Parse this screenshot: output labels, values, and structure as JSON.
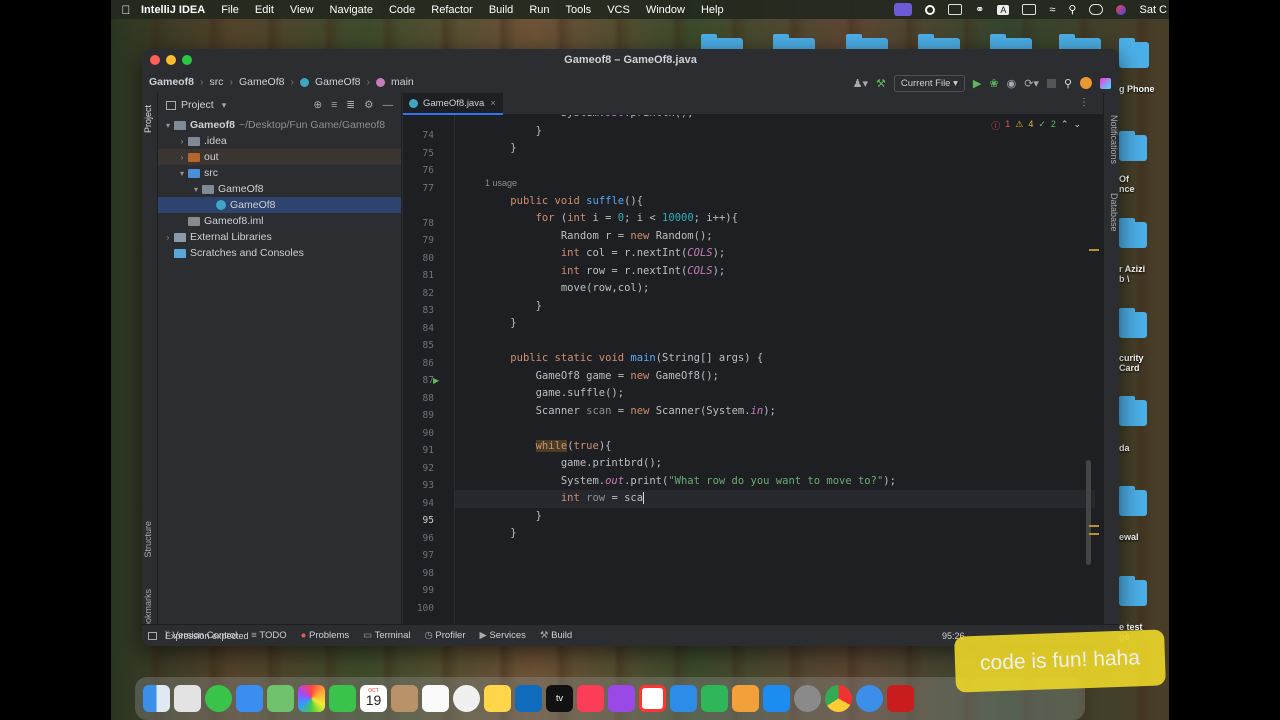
{
  "menubar": {
    "app_name": "IntelliJ IDEA",
    "items": [
      "File",
      "Edit",
      "View",
      "Navigate",
      "Code",
      "Refactor",
      "Build",
      "Run",
      "Tools",
      "VCS",
      "Window",
      "Help"
    ],
    "clock": "Sat C"
  },
  "window": {
    "title": "Gameof8 – GameOf8.java"
  },
  "breadcrumb": [
    "Gameof8",
    "src",
    "GameOf8",
    "GameOf8",
    "main"
  ],
  "run_config": "Current File",
  "project_panel": {
    "title": "Project",
    "tree": [
      {
        "label": "Gameof8",
        "extra": "~/Desktop/Fun Game/Gameof8",
        "indent": 0,
        "arrow": "open",
        "icon": "folder"
      },
      {
        "label": ".idea",
        "indent": 1,
        "arrow": "closed",
        "icon": "folder"
      },
      {
        "label": "out",
        "indent": 1,
        "arrow": "closed",
        "icon": "folder-orange"
      },
      {
        "label": "src",
        "indent": 1,
        "arrow": "open",
        "icon": "folder-blue"
      },
      {
        "label": "GameOf8",
        "indent": 2,
        "arrow": "open",
        "icon": "package"
      },
      {
        "label": "GameOf8",
        "indent": 3,
        "arrow": "",
        "icon": "class",
        "selected": true
      },
      {
        "label": "Gameof8.iml",
        "indent": 1,
        "arrow": "",
        "icon": "file"
      },
      {
        "label": "External Libraries",
        "indent": 0,
        "arrow": "closed",
        "icon": "library"
      },
      {
        "label": "Scratches and Consoles",
        "indent": 0,
        "arrow": "",
        "icon": "scratch"
      }
    ]
  },
  "editor": {
    "tab": "GameOf8.java",
    "inspections": {
      "errors": "1",
      "warnings": "4",
      "ok": "2"
    },
    "usage_hint": "1 usage",
    "lines": [
      {
        "n": "74",
        "html": "            System.<span class='fld'>out</span>.println();"
      },
      {
        "n": "75",
        "html": "        }"
      },
      {
        "n": "76",
        "html": "    }"
      },
      {
        "n": "77",
        "html": ""
      },
      {
        "n": "78",
        "html": "    <span class='kw'>public void</span> <span class='fn'>suffle</span>(){"
      },
      {
        "n": "79",
        "html": "        <span class='kw'>for</span> (<span class='kw'>int</span> i = <span class='num'>0</span>; i &lt; <span class='num'>10000</span>; i++){"
      },
      {
        "n": "80",
        "html": "            Random r = <span class='kw'>new</span> Random();"
      },
      {
        "n": "81",
        "html": "            <span class='kw'>int</span> col = r.nextInt(<span class='sfld'>COLS</span>);"
      },
      {
        "n": "82",
        "html": "            <span class='kw'>int</span> row = r.nextInt(<span class='sfld'>COLS</span>);"
      },
      {
        "n": "83",
        "html": "            move(row,col);"
      },
      {
        "n": "84",
        "html": "        }"
      },
      {
        "n": "85",
        "html": "    }"
      },
      {
        "n": "86",
        "html": ""
      },
      {
        "n": "87",
        "html": "    <span class='kw'>public static void</span> <span class='fn'>main</span>(String[] args) {"
      },
      {
        "n": "88",
        "html": "        GameOf8 game = <span class='kw'>new</span> GameOf8();"
      },
      {
        "n": "89",
        "html": "        game.suffle();"
      },
      {
        "n": "90",
        "html": "        Scanner <span class='ph'>scan</span> = <span class='kw'>new</span> Scanner(System.<span class='fld'>in</span>);"
      },
      {
        "n": "91",
        "html": ""
      },
      {
        "n": "92",
        "html": "        <span class='kw' style='background:#4a3f26'>while</span>(<span class='kw'>true</span>){"
      },
      {
        "n": "93",
        "html": "            game.printbrd();"
      },
      {
        "n": "94",
        "html": "            System.<span class='fld'>out</span>.print(<span class='str'>\"What row do you want to move to?\"</span>);"
      },
      {
        "n": "95",
        "html": "            <span class='kw'>int</span> <span class='ph'>row</span> = sca<span style='border-left:1px solid #ddd'></span>"
      },
      {
        "n": "96",
        "html": "        }"
      },
      {
        "n": "97",
        "html": "    }"
      },
      {
        "n": "98",
        "html": ""
      },
      {
        "n": "99",
        "html": ""
      },
      {
        "n": "100",
        "html": ""
      }
    ]
  },
  "bottom_tools": [
    "Version Control",
    "TODO",
    "Problems",
    "Terminal",
    "Profiler",
    "Services",
    "Build"
  ],
  "status": {
    "message": "Expression expected",
    "position": "95:26"
  },
  "side_tabs": {
    "left": [
      "Project",
      "Structure",
      "Bookmarks"
    ],
    "right": [
      "Notifications",
      "Database"
    ]
  },
  "desktop_labels": [
    "g Phone",
    "Of\nnce",
    "r Azizi\nb \\",
    "curity\nCard",
    "da",
    "ewal",
    "e test\nge"
  ],
  "dock": {
    "calendar_day": "19",
    "calendar_month": "OCT"
  },
  "caption": "code is fun! haha"
}
